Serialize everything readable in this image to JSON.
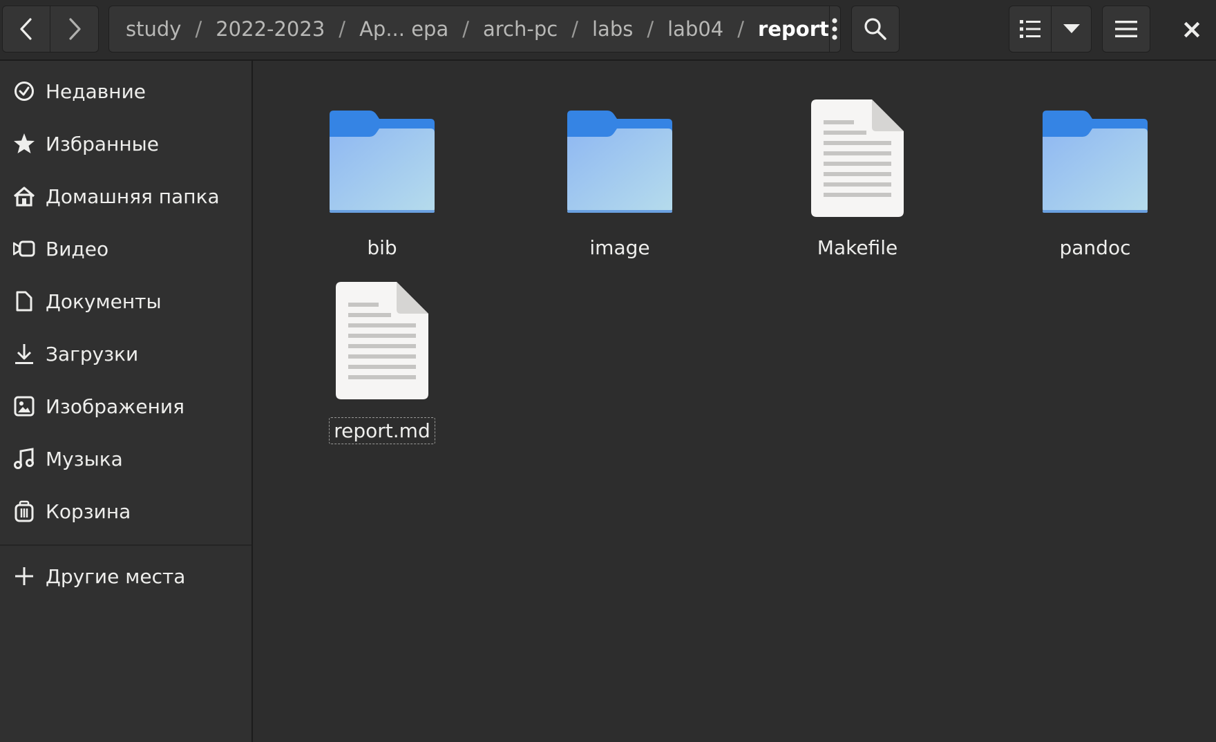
{
  "header": {
    "back_label": "Назад",
    "forward_label": "Вперёд",
    "path": [
      "study",
      "2022-2023",
      "Ар... ера",
      "arch-pc",
      "labs",
      "lab04",
      "report"
    ],
    "separator": "/",
    "close_label": "×"
  },
  "sidebar": {
    "items": [
      {
        "label": "Недавние",
        "icon": "clock-icon"
      },
      {
        "label": "Избранные",
        "icon": "star-icon"
      },
      {
        "label": "Домашняя папка",
        "icon": "home-icon"
      },
      {
        "label": "Видео",
        "icon": "video-icon"
      },
      {
        "label": "Документы",
        "icon": "document-icon"
      },
      {
        "label": "Загрузки",
        "icon": "download-icon"
      },
      {
        "label": "Изображения",
        "icon": "image-icon"
      },
      {
        "label": "Музыка",
        "icon": "music-icon"
      },
      {
        "label": "Корзина",
        "icon": "trash-icon"
      }
    ],
    "other_places": {
      "label": "Другие места",
      "icon": "plus-icon"
    }
  },
  "files": [
    {
      "name": "bib",
      "type": "folder"
    },
    {
      "name": "image",
      "type": "folder"
    },
    {
      "name": "Makefile",
      "type": "file"
    },
    {
      "name": "pandoc",
      "type": "folder"
    },
    {
      "name": "report.md",
      "type": "file",
      "state": "renaming"
    }
  ],
  "colors": {
    "background": "#2d2d2d",
    "sidebar": "#303030",
    "folder_top": "#3584e4",
    "folder_body": "#99c1f1",
    "file_page": "#f6f5f4"
  }
}
